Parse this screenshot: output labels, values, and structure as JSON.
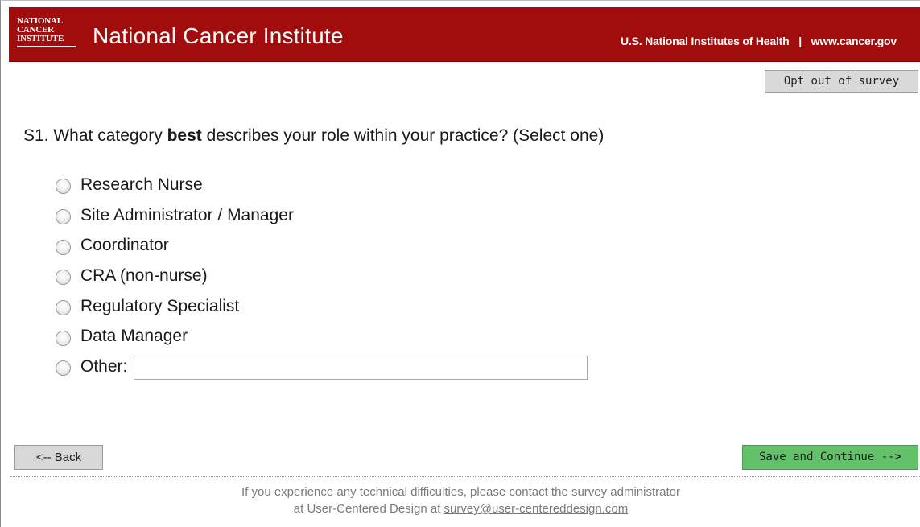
{
  "header": {
    "logo_lines": [
      "NATIONAL",
      "CANCER",
      "INSTITUTE"
    ],
    "title": "National Cancer Institute",
    "links": [
      "U.S. National Institutes of Health",
      "www.cancer.gov"
    ],
    "separator": "|"
  },
  "opt_out_label": "Opt out of survey",
  "question": {
    "prefix": "S1. What category ",
    "emphasis": "best",
    "suffix": " describes your role within your practice? (Select one)"
  },
  "options": [
    {
      "label": "Research Nurse"
    },
    {
      "label": "Site Administrator / Manager"
    },
    {
      "label": "Coordinator"
    },
    {
      "label": "CRA (non-nurse)"
    },
    {
      "label": "Regulatory Specialist"
    },
    {
      "label": "Data Manager"
    },
    {
      "label": "Other:"
    }
  ],
  "other_input_value": "",
  "back_label": "<-- Back",
  "save_label": "Save and Continue -->",
  "footer": {
    "line1": "If you experience any technical difficulties, please contact the survey administrator",
    "line2_prefix": "at User-Centered Design at ",
    "email": "survey@user-centereddesign.com"
  },
  "colors": {
    "header_bg": "#a10d0d",
    "save_button_bg": "#63c06b"
  }
}
